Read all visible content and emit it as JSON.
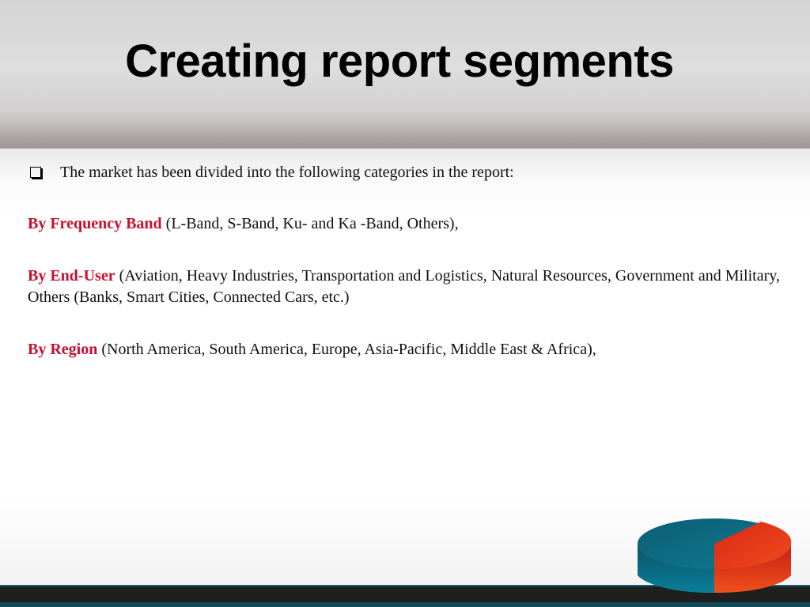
{
  "slide": {
    "title": "Creating report segments",
    "intro": "The market has been divided into the following categories in the report:",
    "segments": [
      {
        "label": "By Frequency Band",
        "text": " (L-Band, S-Band, Ku- and Ka -Band, Others),"
      },
      {
        "label": "By End-User",
        "text": " (Aviation, Heavy Industries, Transportation and Logistics, Natural Resources, Government and Military, Others (Banks, Smart Cities, Connected Cars, etc.)"
      },
      {
        "label": "By Region",
        "text": " (North America, South America, Europe, Asia-Pacific, Middle East & Africa),"
      }
    ]
  },
  "colors": {
    "label": "#c8102e",
    "logo_teal": "#0e6f86",
    "logo_red": "#e8311e",
    "footer": "#1f1f1f"
  },
  "icons": [
    "checkbox-bullet-icon",
    "pie-chart-logo-icon"
  ]
}
